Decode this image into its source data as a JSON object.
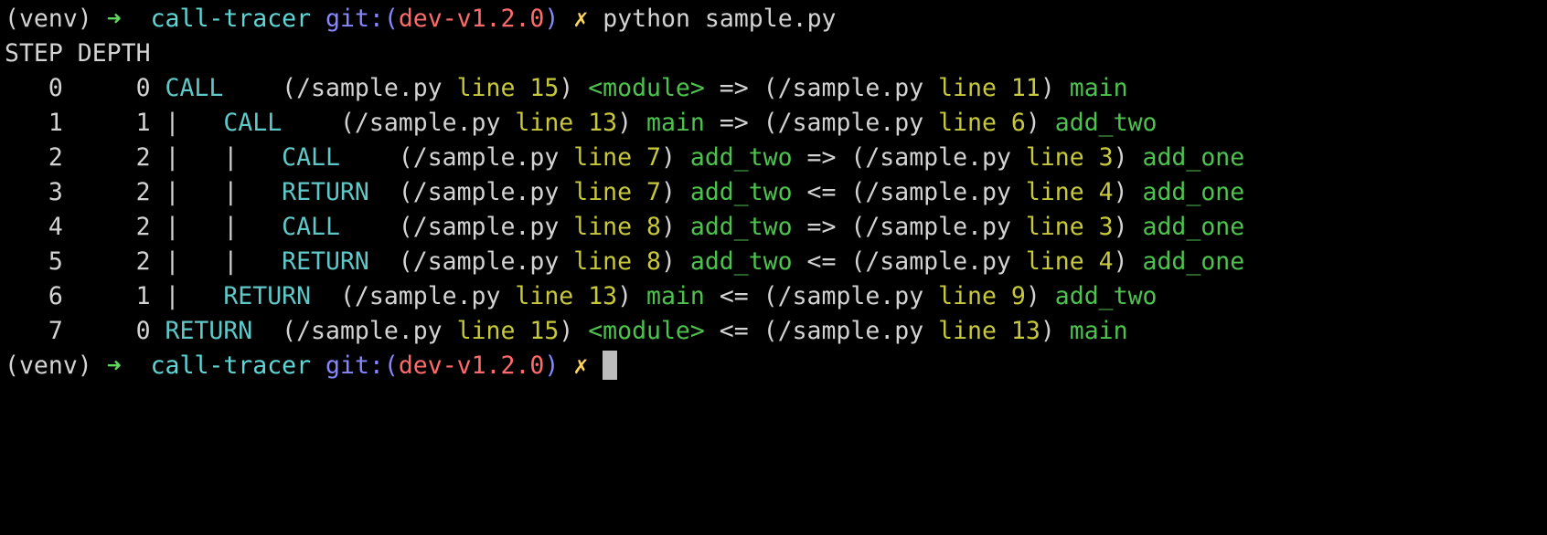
{
  "colors": {
    "background": "#000000",
    "default": "#d3d3d3",
    "prompt_arrow": "#5fd75f",
    "directory": "#5fd7d7",
    "git_label": "#8787ff",
    "git_branch": "#ff6b6b",
    "dirty_mark": "#ffd75f",
    "event": "#5fc8c8",
    "line_number": "#c8c83c",
    "function_name": "#4ec24e",
    "cursor": "#bdbdbd"
  },
  "terminal": {
    "lines": [
      {
        "name": "prompt-line-command",
        "segments": [
          {
            "text": "(venv) ",
            "color": "default"
          },
          {
            "text": "➜",
            "color": "prompt_arrow"
          },
          {
            "text": "  ",
            "color": "default"
          },
          {
            "text": "call-tracer",
            "color": "directory"
          },
          {
            "text": " ",
            "color": "default"
          },
          {
            "text": "git:(",
            "color": "git_label"
          },
          {
            "text": "dev-v1.2.0",
            "color": "git_branch"
          },
          {
            "text": ")",
            "color": "git_label"
          },
          {
            "text": " ",
            "color": "default"
          },
          {
            "text": "✗",
            "color": "dirty_mark"
          },
          {
            "text": " python sample.py",
            "color": "default"
          }
        ]
      },
      {
        "name": "trace-header",
        "segments": [
          {
            "text": "STEP DEPTH",
            "color": "default"
          }
        ]
      },
      {
        "name": "trace-row-0",
        "segments": [
          {
            "text": "   0     0 ",
            "color": "default"
          },
          {
            "text": "CALL    ",
            "color": "event"
          },
          {
            "text": "(/sample.py ",
            "color": "default"
          },
          {
            "text": "line 15",
            "color": "line_number"
          },
          {
            "text": ") ",
            "color": "default"
          },
          {
            "text": "<module>",
            "color": "function_name"
          },
          {
            "text": " => (/sample.py ",
            "color": "default"
          },
          {
            "text": "line 11",
            "color": "line_number"
          },
          {
            "text": ") ",
            "color": "default"
          },
          {
            "text": "main",
            "color": "function_name"
          }
        ]
      },
      {
        "name": "trace-row-1",
        "segments": [
          {
            "text": "   1     1 |   ",
            "color": "default"
          },
          {
            "text": "CALL    ",
            "color": "event"
          },
          {
            "text": "(/sample.py ",
            "color": "default"
          },
          {
            "text": "line 13",
            "color": "line_number"
          },
          {
            "text": ") ",
            "color": "default"
          },
          {
            "text": "main",
            "color": "function_name"
          },
          {
            "text": " => (/sample.py ",
            "color": "default"
          },
          {
            "text": "line 6",
            "color": "line_number"
          },
          {
            "text": ") ",
            "color": "default"
          },
          {
            "text": "add_two",
            "color": "function_name"
          }
        ]
      },
      {
        "name": "trace-row-2",
        "segments": [
          {
            "text": "   2     2 |   |   ",
            "color": "default"
          },
          {
            "text": "CALL    ",
            "color": "event"
          },
          {
            "text": "(/sample.py ",
            "color": "default"
          },
          {
            "text": "line 7",
            "color": "line_number"
          },
          {
            "text": ") ",
            "color": "default"
          },
          {
            "text": "add_two",
            "color": "function_name"
          },
          {
            "text": " => (/sample.py ",
            "color": "default"
          },
          {
            "text": "line 3",
            "color": "line_number"
          },
          {
            "text": ") ",
            "color": "default"
          },
          {
            "text": "add_one",
            "color": "function_name"
          }
        ]
      },
      {
        "name": "trace-row-3",
        "segments": [
          {
            "text": "   3     2 |   |   ",
            "color": "default"
          },
          {
            "text": "RETURN  ",
            "color": "event"
          },
          {
            "text": "(/sample.py ",
            "color": "default"
          },
          {
            "text": "line 7",
            "color": "line_number"
          },
          {
            "text": ") ",
            "color": "default"
          },
          {
            "text": "add_two",
            "color": "function_name"
          },
          {
            "text": " <= (/sample.py ",
            "color": "default"
          },
          {
            "text": "line 4",
            "color": "line_number"
          },
          {
            "text": ") ",
            "color": "default"
          },
          {
            "text": "add_one",
            "color": "function_name"
          }
        ]
      },
      {
        "name": "trace-row-4",
        "segments": [
          {
            "text": "   4     2 |   |   ",
            "color": "default"
          },
          {
            "text": "CALL    ",
            "color": "event"
          },
          {
            "text": "(/sample.py ",
            "color": "default"
          },
          {
            "text": "line 8",
            "color": "line_number"
          },
          {
            "text": ") ",
            "color": "default"
          },
          {
            "text": "add_two",
            "color": "function_name"
          },
          {
            "text": " => (/sample.py ",
            "color": "default"
          },
          {
            "text": "line 3",
            "color": "line_number"
          },
          {
            "text": ") ",
            "color": "default"
          },
          {
            "text": "add_one",
            "color": "function_name"
          }
        ]
      },
      {
        "name": "trace-row-5",
        "segments": [
          {
            "text": "   5     2 |   |   ",
            "color": "default"
          },
          {
            "text": "RETURN  ",
            "color": "event"
          },
          {
            "text": "(/sample.py ",
            "color": "default"
          },
          {
            "text": "line 8",
            "color": "line_number"
          },
          {
            "text": ") ",
            "color": "default"
          },
          {
            "text": "add_two",
            "color": "function_name"
          },
          {
            "text": " <= (/sample.py ",
            "color": "default"
          },
          {
            "text": "line 4",
            "color": "line_number"
          },
          {
            "text": ") ",
            "color": "default"
          },
          {
            "text": "add_one",
            "color": "function_name"
          }
        ]
      },
      {
        "name": "trace-row-6",
        "segments": [
          {
            "text": "   6     1 |   ",
            "color": "default"
          },
          {
            "text": "RETURN  ",
            "color": "event"
          },
          {
            "text": "(/sample.py ",
            "color": "default"
          },
          {
            "text": "line 13",
            "color": "line_number"
          },
          {
            "text": ") ",
            "color": "default"
          },
          {
            "text": "main",
            "color": "function_name"
          },
          {
            "text": " <= (/sample.py ",
            "color": "default"
          },
          {
            "text": "line 9",
            "color": "line_number"
          },
          {
            "text": ") ",
            "color": "default"
          },
          {
            "text": "add_two",
            "color": "function_name"
          }
        ]
      },
      {
        "name": "trace-row-7",
        "segments": [
          {
            "text": "   7     0 ",
            "color": "default"
          },
          {
            "text": "RETURN  ",
            "color": "event"
          },
          {
            "text": "(/sample.py ",
            "color": "default"
          },
          {
            "text": "line 15",
            "color": "line_number"
          },
          {
            "text": ") ",
            "color": "default"
          },
          {
            "text": "<module>",
            "color": "function_name"
          },
          {
            "text": " <= (/sample.py ",
            "color": "default"
          },
          {
            "text": "line 13",
            "color": "line_number"
          },
          {
            "text": ") ",
            "color": "default"
          },
          {
            "text": "main",
            "color": "function_name"
          }
        ]
      },
      {
        "name": "prompt-line-current",
        "segments": [
          {
            "text": "(venv) ",
            "color": "default"
          },
          {
            "text": "➜",
            "color": "prompt_arrow"
          },
          {
            "text": "  ",
            "color": "default"
          },
          {
            "text": "call-tracer",
            "color": "directory"
          },
          {
            "text": " ",
            "color": "default"
          },
          {
            "text": "git:(",
            "color": "git_label"
          },
          {
            "text": "dev-v1.2.0",
            "color": "git_branch"
          },
          {
            "text": ")",
            "color": "git_label"
          },
          {
            "text": " ",
            "color": "default"
          },
          {
            "text": "✗",
            "color": "dirty_mark"
          },
          {
            "text": " ",
            "color": "default"
          }
        ],
        "cursor": true
      }
    ]
  }
}
